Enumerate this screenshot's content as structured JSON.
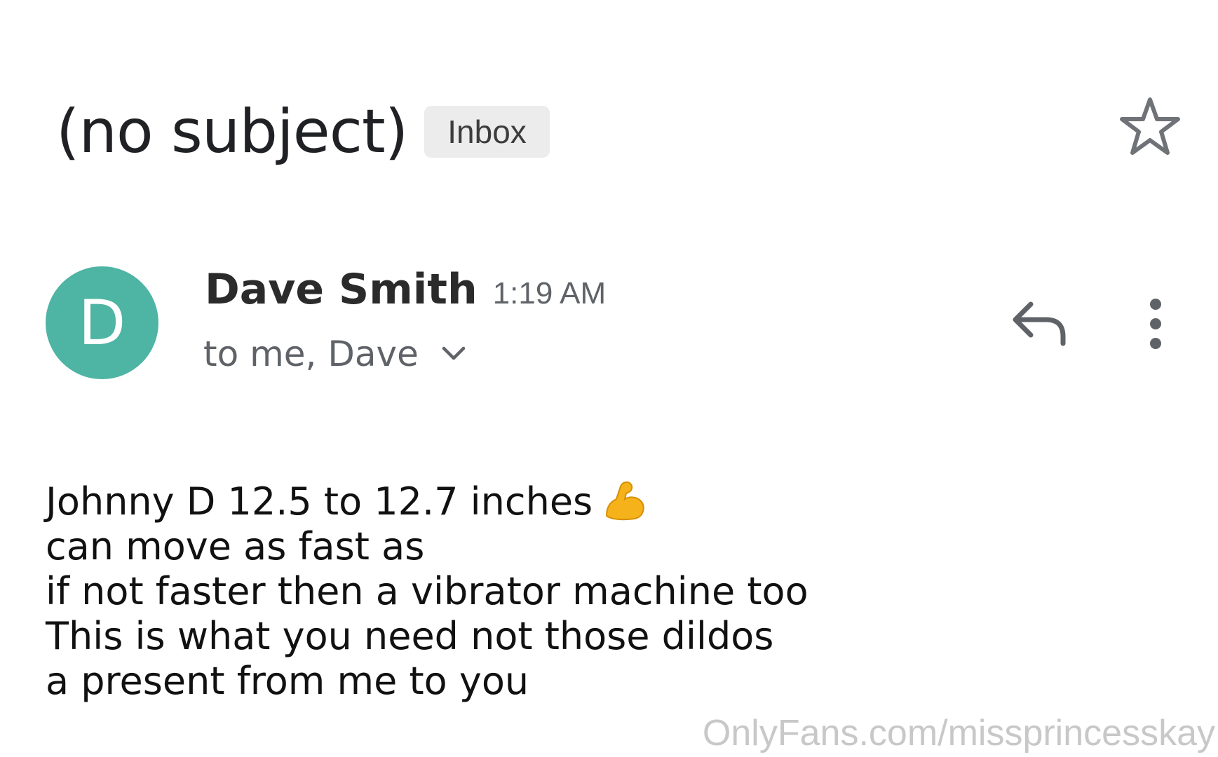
{
  "email": {
    "subject": "(no subject)",
    "label": "Inbox",
    "sender": {
      "initial": "D",
      "name": "Dave Smith",
      "time": "1:19 AM",
      "recipients": "to me, Dave"
    },
    "body_lines": [
      "Johnny D 12.5 to 12.7 inches",
      "can move as fast as",
      "if not faster then a vibrator machine too",
      "This is what you need not those dildos",
      "a present from me to you"
    ],
    "emoji": "flexed-biceps"
  },
  "icons": {
    "star": "star-outline-icon",
    "reply": "reply-icon",
    "more": "more-vert-icon",
    "chevron": "chevron-down-icon"
  },
  "colors": {
    "avatar": "#4eb4a3",
    "chip_bg": "#ececec",
    "secondary_text": "#5f6368",
    "emoji": "#f5b21b"
  },
  "watermark": "OnlyFans.com/missprincesskay"
}
